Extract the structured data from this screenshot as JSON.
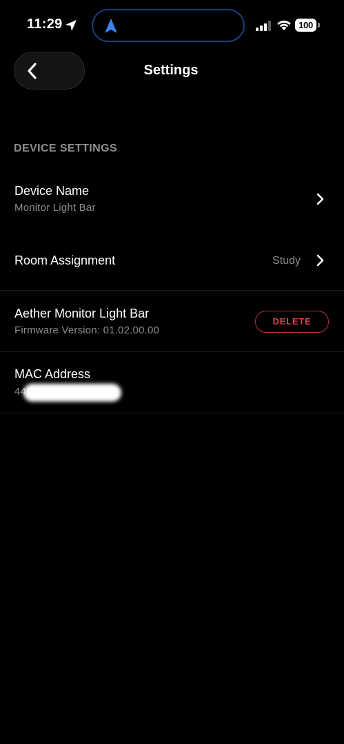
{
  "status_bar": {
    "time": "11:29",
    "battery": "100"
  },
  "header": {
    "title": "Settings"
  },
  "section": {
    "title": "DEVICE SETTINGS"
  },
  "rows": {
    "device_name": {
      "title": "Device Name",
      "subtitle": "Monitor Light Bar"
    },
    "room": {
      "title": "Room Assignment",
      "value": "Study"
    },
    "firmware": {
      "title": "Aether Monitor Light Bar",
      "subtitle": "Firmware Version: 01.02.00.00",
      "delete_label": "DELETE"
    },
    "mac": {
      "title": "MAC Address",
      "subtitle": "44"
    }
  },
  "colors": {
    "background": "#000000",
    "text_primary": "#ffffff",
    "text_secondary": "#8d8d8d",
    "danger": "#d2474a",
    "accent_blue": "#3b82f6"
  },
  "icons": {
    "location": "location-arrow-icon",
    "island": "navigation-arrow-icon",
    "signal": "cellular-signal-icon",
    "wifi": "wifi-icon",
    "back": "chevron-left-icon",
    "row": "chevron-right-icon"
  }
}
